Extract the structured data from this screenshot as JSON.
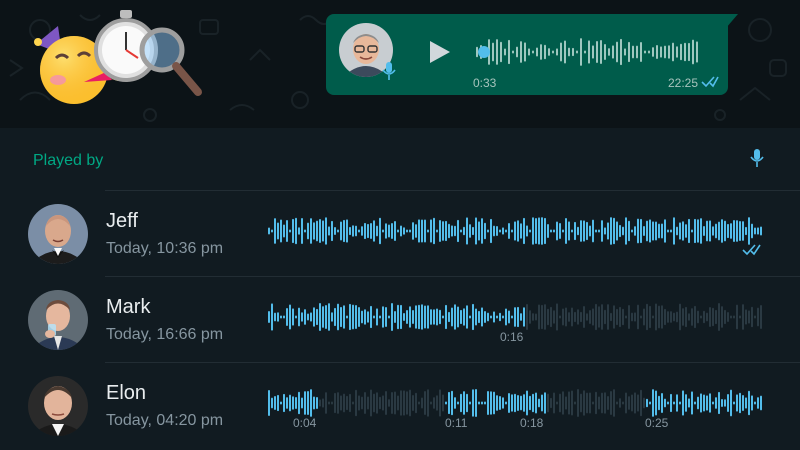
{
  "message": {
    "duration": "0:33",
    "time": "22:25",
    "status": "read",
    "icons": {
      "play": "play-icon",
      "mic": "mic-icon",
      "ticks": "double-check-icon"
    }
  },
  "panel": {
    "header": "Played by",
    "header_icon": "mic-icon"
  },
  "listeners": [
    {
      "name": "Jeff",
      "time": "Today, 10:36 pm",
      "played_fraction": 1.0,
      "segments": [
        [
          0,
          1
        ]
      ],
      "marks": [],
      "read_ticks": true
    },
    {
      "name": "Mark",
      "time": "Today, 16:66 pm",
      "played_fraction": 0.52,
      "segments": [
        [
          0,
          0.52
        ]
      ],
      "marks": [
        "0:16"
      ],
      "read_ticks": false
    },
    {
      "name": "Elon",
      "time": "Today, 04:20 pm",
      "played_fraction": 0.6,
      "segments": [
        [
          0,
          0.1
        ],
        [
          0.355,
          0.56
        ],
        [
          0.76,
          1
        ]
      ],
      "marks": [
        "0:04",
        "0:11",
        "0:18",
        "0:25"
      ],
      "read_ticks": false
    }
  ],
  "colors": {
    "accent": "#00a884",
    "bubble": "#005c4b",
    "wave_played": "#53bdeb",
    "wave_unplayed": "#2a3942",
    "background": "#111b21",
    "chat_background": "#0c1317"
  }
}
